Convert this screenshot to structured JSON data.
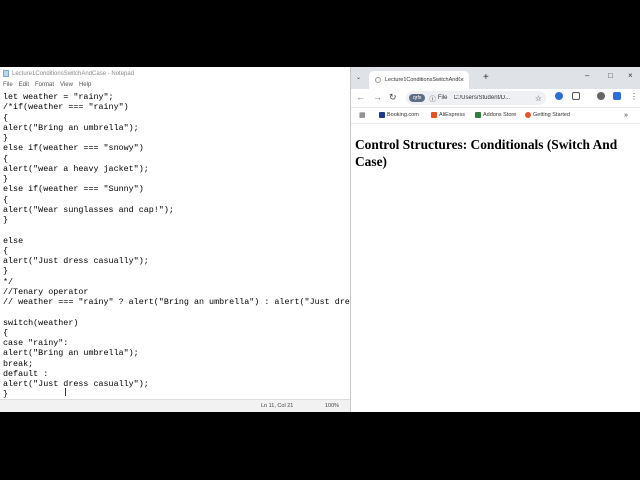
{
  "notepad": {
    "title": "Lecture1ConditionsSwitchAndCase - Notepad",
    "menu": [
      "File",
      "Edit",
      "Format",
      "View",
      "Help"
    ],
    "lines": [
      "let weather = \"rainy\";",
      "/*if(weather === \"rainy\")",
      "{",
      "alert(\"Bring an umbrella\");",
      "}",
      "else if(weather === \"snowy\")",
      "{",
      "alert(\"wear a heavy jacket\");",
      "}",
      "else if(weather === \"Sunny\")",
      "{",
      "alert(\"Wear sunglasses and cap!\");",
      "}",
      "",
      "else",
      "{",
      "alert(\"Just dress casually\");",
      "}",
      "*/",
      "//Tenary operator",
      "// weather === \"rainy\" ? alert(\"Bring an umbrella\") : alert(\"Just dress ca",
      "",
      "switch(weather)",
      "{",
      "case \"rainy\":",
      "alert(\"Bring an umbrella\");",
      "break;",
      "default :",
      "alert(\"Just dress casually\");",
      "}"
    ],
    "status": {
      "position": "Ln 11, Col 21",
      "zoom": "100%"
    }
  },
  "browser": {
    "tab_title": "Lecture1ConditionsSwitchAndCase",
    "omnibox": {
      "chip": "qrfx",
      "scheme": "File",
      "url": "C:/Users/Student/D..."
    },
    "bookmarks": [
      {
        "label": "Booking.com",
        "color": "#1b3a8c"
      },
      {
        "label": "AliExpress",
        "color": "#e8501d"
      },
      {
        "label": "Addons Store",
        "color": "#2f7d3f"
      },
      {
        "label": "Getting Started",
        "color": "#e5542b"
      }
    ],
    "heading": "Control Structures: Conditionals (Switch And Case)"
  }
}
